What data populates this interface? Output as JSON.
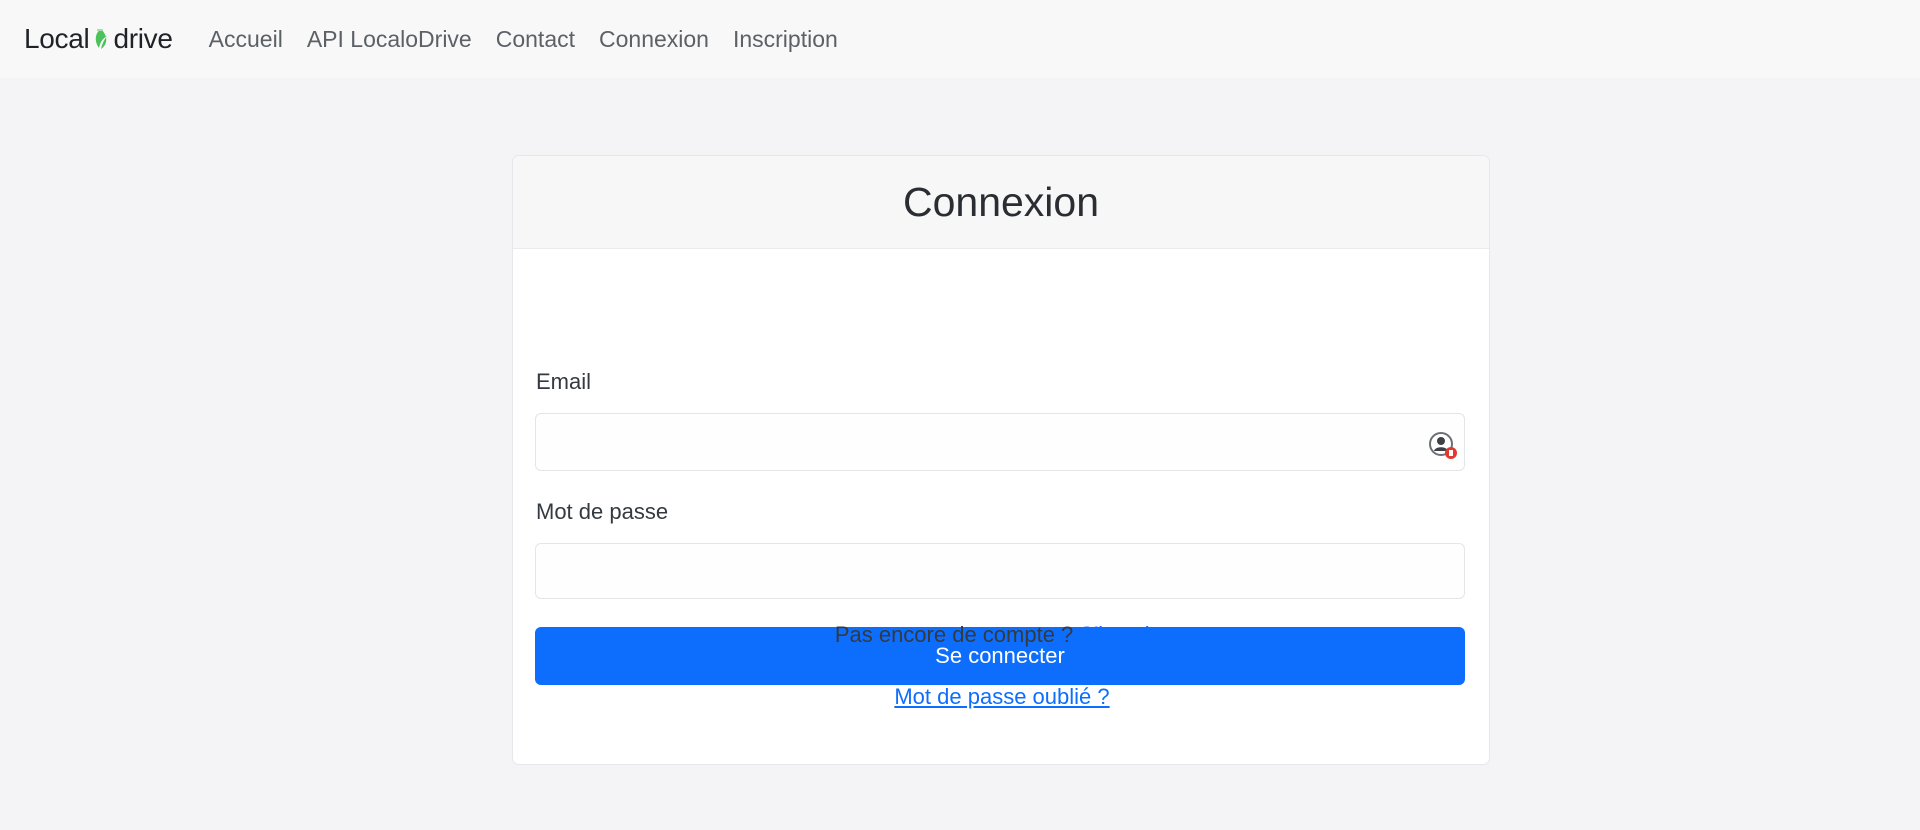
{
  "navbar": {
    "brand": {
      "prefix": "Local",
      "suffix": "drive",
      "logo_icon": "leaf-logo-icon",
      "accent_color": "#4cc25a"
    },
    "links": [
      {
        "label": "Accueil"
      },
      {
        "label": "API LocaloDrive"
      },
      {
        "label": "Contact"
      },
      {
        "label": "Connexion"
      },
      {
        "label": "Inscription"
      }
    ]
  },
  "login_card": {
    "title": "Connexion",
    "email": {
      "label": "Email",
      "value": "",
      "placeholder": "",
      "autofill_icon": "password-manager-icon"
    },
    "password": {
      "label": "Mot de passe",
      "value": "",
      "placeholder": ""
    },
    "submit_label": "Se connecter",
    "signup_prompt": "Pas encore de compte ?",
    "signup_link": "S'inscrire",
    "forgot_link": "Mot de passe oublié ?"
  },
  "colors": {
    "primary": "#0d6efd",
    "link": "#0d6efd",
    "background": "#f4f4f6"
  }
}
